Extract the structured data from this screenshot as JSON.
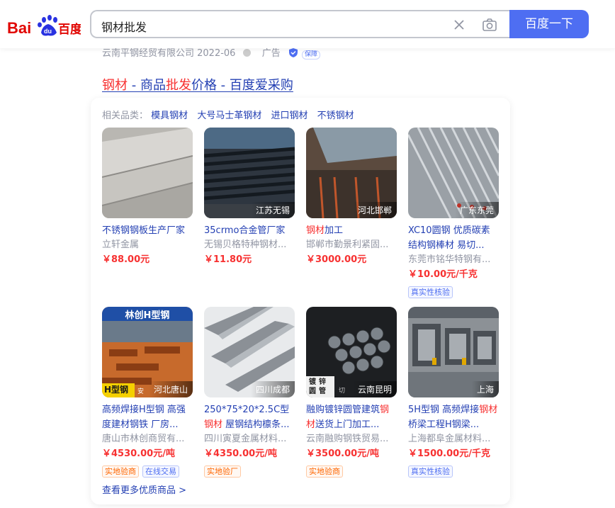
{
  "header": {
    "logo_text": "Bai百度",
    "search_value": "钢材批发",
    "search_button": "百度一下"
  },
  "result_meta": {
    "company": "云南平钢经贸有限公司 2022-06",
    "ad_label": "广告",
    "guarantee_label": "保障"
  },
  "result_title": {
    "part1_hl": "钢材",
    "part2": " - 商品",
    "part3_hl": "批发",
    "part4": "价格 - 百度爱采购"
  },
  "related": {
    "label": "相关品类：",
    "items": [
      "模具钢材",
      "大号马士革钢材",
      "进口钢材",
      "不锈钢材"
    ]
  },
  "products": [
    {
      "name": "不锈钢钢板生产厂家",
      "seller": "立轩金属",
      "price": "￥88.00元",
      "location": "",
      "tags": []
    },
    {
      "name": "35crmo合金管厂家",
      "seller": "无锡贝格特种钢材...",
      "price": "￥11.80元",
      "location": "江苏无锡",
      "tags": []
    },
    {
      "name_hl": "钢材",
      "name_rest": "加工",
      "seller": "邯郸市勤景利紧固...",
      "price": "￥3000.00元",
      "location": "河北邯郸",
      "tags": []
    },
    {
      "name": "XC10圆钢 优质碳素结构钢棒材 易切...",
      "seller": "东莞市铭华特钢有...",
      "price": "￥10.00元/千克",
      "location": "广东东莞",
      "tags": [
        "真实性核验"
      ]
    },
    {
      "name": "高频焊接H型钢 高强度建材钢铁 厂房...",
      "seller": "唐山市林创商贸有...",
      "price": "￥4530.00元/吨",
      "location": "河北唐山",
      "img_title": "林创H型钢",
      "img_badge": "H型钢",
      "img_badge2": "安",
      "tags": [
        "实地验商",
        "在线交易"
      ]
    },
    {
      "name_pre": "250*75*20*2.5C型",
      "name_hl": "钢材",
      "name_rest": " 屋钢结构檩条...",
      "seller": "四川寅夏金属材料...",
      "price": "￥4350.00元/吨",
      "location": "四川成都",
      "tags": [
        "实地验厂"
      ]
    },
    {
      "name_pre": "融购镀锌圆管建筑",
      "name_hl": "钢材",
      "name_rest": "送货上门加工...",
      "seller": "云南融购钢铁贸易...",
      "price": "￥3500.00元/吨",
      "location": "云南昆明",
      "img_label": "镀锌圆管",
      "img_label2": "切",
      "tags": [
        "实地验商"
      ]
    },
    {
      "name_pre": "5H型钢 高频焊接",
      "name_hl": "钢材",
      "name_rest": "桥梁工程H钢梁...",
      "seller": "上海都阜金属材料...",
      "price": "￥1500.00元/千克",
      "location": "上海",
      "tags": [
        "真实性核验"
      ]
    }
  ],
  "more_link": "查看更多优质商品 >",
  "colors": {
    "accent": "#4e6ef2",
    "link": "#2440b3",
    "highlight": "#f73131",
    "tag_orange": "#ff6600"
  }
}
